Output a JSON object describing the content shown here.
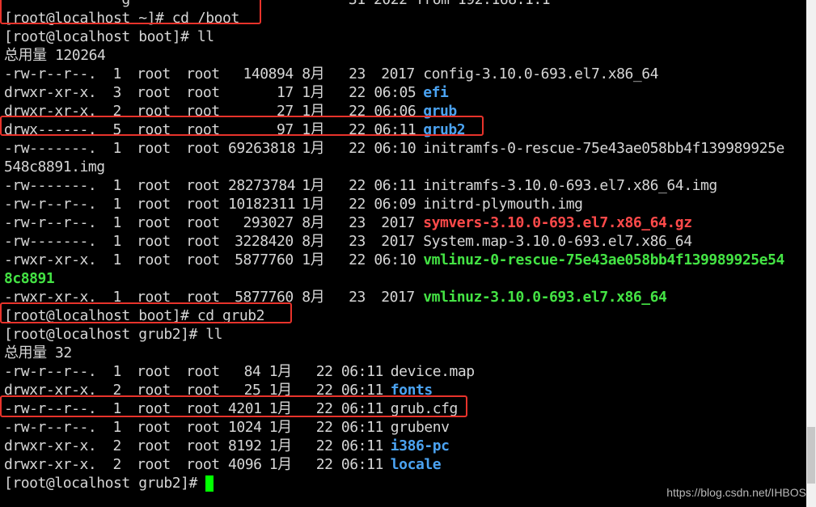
{
  "colors": {
    "background": "#000000",
    "text": "#d6d6d6",
    "directory": "#4ba3f2",
    "executable": "#44e344",
    "archive": "#ff4a4a",
    "highlight": "#e8332b",
    "cursor": "#00ff00"
  },
  "terminal": {
    "partial_top_line": "              g                          31 2022 from 192.168.1.1",
    "cmd_cd_boot": "[root@localhost ~]# cd /boot",
    "cmd_ll_boot": "[root@localhost boot]# ll",
    "total_boot": "总用量 120264",
    "boot_listing": [
      {
        "perms": "-rw-r--r--.",
        "links": "1",
        "owner": "root",
        "group": "root",
        "size": "140894",
        "month": "8月",
        "day": "23",
        "time": "2017",
        "name": "config-3.10.0-693.el7.x86_64",
        "kind": "file"
      },
      {
        "perms": "drwxr-xr-x.",
        "links": "3",
        "owner": "root",
        "group": "root",
        "size": "17",
        "month": "1月",
        "day": "22",
        "time": "06:05",
        "name": "efi",
        "kind": "dir"
      },
      {
        "perms": "drwxr-xr-x.",
        "links": "2",
        "owner": "root",
        "group": "root",
        "size": "27",
        "month": "1月",
        "day": "22",
        "time": "06:06",
        "name": "grub",
        "kind": "dir"
      },
      {
        "perms": "drwx------.",
        "links": "5",
        "owner": "root",
        "group": "root",
        "size": "97",
        "month": "1月",
        "day": "22",
        "time": "06:11",
        "name": "grub2",
        "kind": "dir"
      },
      {
        "perms": "-rw-------.",
        "links": "1",
        "owner": "root",
        "group": "root",
        "size": "69263818",
        "month": "1月",
        "day": "22",
        "time": "06:10",
        "name": "initramfs-0-rescue-75e43ae058bb4f139989925e",
        "name_cont": "548c8891.img",
        "kind": "file"
      },
      {
        "perms": "-rw-------.",
        "links": "1",
        "owner": "root",
        "group": "root",
        "size": "28273784",
        "month": "1月",
        "day": "22",
        "time": "06:11",
        "name": "initramfs-3.10.0-693.el7.x86_64.img",
        "kind": "file"
      },
      {
        "perms": "-rw-r--r--.",
        "links": "1",
        "owner": "root",
        "group": "root",
        "size": "10182311",
        "month": "1月",
        "day": "22",
        "time": "06:09",
        "name": "initrd-plymouth.img",
        "kind": "file"
      },
      {
        "perms": "-rw-r--r--.",
        "links": "1",
        "owner": "root",
        "group": "root",
        "size": "293027",
        "month": "8月",
        "day": "23",
        "time": "2017",
        "name": "symvers-3.10.0-693.el7.x86_64.gz",
        "kind": "archive"
      },
      {
        "perms": "-rw-------.",
        "links": "1",
        "owner": "root",
        "group": "root",
        "size": "3228420",
        "month": "8月",
        "day": "23",
        "time": "2017",
        "name": "System.map-3.10.0-693.el7.x86_64",
        "kind": "file"
      },
      {
        "perms": "-rwxr-xr-x.",
        "links": "1",
        "owner": "root",
        "group": "root",
        "size": "5877760",
        "month": "1月",
        "day": "22",
        "time": "06:10",
        "name": "vmlinuz-0-rescue-75e43ae058bb4f139989925e54",
        "name_cont": "8c8891",
        "kind": "exec"
      },
      {
        "perms": "-rwxr-xr-x.",
        "links": "1",
        "owner": "root",
        "group": "root",
        "size": "5877760",
        "month": "8月",
        "day": "23",
        "time": "2017",
        "name": "vmlinuz-3.10.0-693.el7.x86_64",
        "kind": "exec"
      }
    ],
    "cmd_cd_grub2": "[root@localhost boot]# cd grub2",
    "cmd_ll_grub2": "[root@localhost grub2]# ll",
    "total_grub2": "总用量 32",
    "grub2_listing": [
      {
        "perms": "-rw-r--r--.",
        "links": "1",
        "owner": "root",
        "group": "root",
        "size": "84",
        "month": "1月",
        "day": "22",
        "time": "06:11",
        "name": "device.map",
        "kind": "file"
      },
      {
        "perms": "drwxr-xr-x.",
        "links": "2",
        "owner": "root",
        "group": "root",
        "size": "25",
        "month": "1月",
        "day": "22",
        "time": "06:11",
        "name": "fonts",
        "kind": "dir"
      },
      {
        "perms": "-rw-r--r--.",
        "links": "1",
        "owner": "root",
        "group": "root",
        "size": "4201",
        "month": "1月",
        "day": "22",
        "time": "06:11",
        "name": "grub.cfg",
        "kind": "file"
      },
      {
        "perms": "-rw-r--r--.",
        "links": "1",
        "owner": "root",
        "group": "root",
        "size": "1024",
        "month": "1月",
        "day": "22",
        "time": "06:11",
        "name": "grubenv",
        "kind": "file"
      },
      {
        "perms": "drwxr-xr-x.",
        "links": "2",
        "owner": "root",
        "group": "root",
        "size": "8192",
        "month": "1月",
        "day": "22",
        "time": "06:11",
        "name": "i386-pc",
        "kind": "dir"
      },
      {
        "perms": "drwxr-xr-x.",
        "links": "2",
        "owner": "root",
        "group": "root",
        "size": "4096",
        "month": "1月",
        "day": "22",
        "time": "06:11",
        "name": "locale",
        "kind": "dir"
      }
    ],
    "final_prompt": "[root@localhost grub2]# "
  },
  "watermark": "https://blog.csdn.net/IHBOS"
}
